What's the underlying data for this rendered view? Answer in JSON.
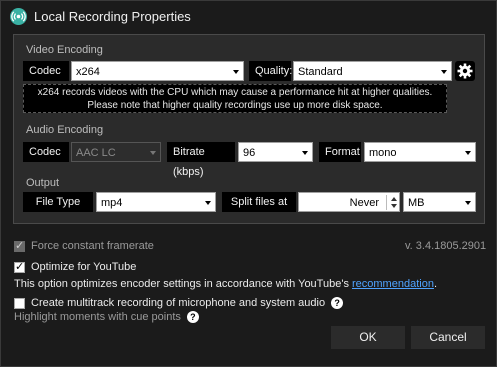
{
  "window": {
    "title": "Local Recording Properties"
  },
  "video": {
    "section_label": "Video Encoding",
    "codec_label": "Codec",
    "codec_value": "x264",
    "quality_label": "Quality:",
    "quality_value": "Standard",
    "info_line1": "x264 records videos with the CPU which may cause a performance hit at higher qualities.",
    "info_line2": "Please note that higher quality recordings use up more disk space."
  },
  "audio": {
    "section_label": "Audio Encoding",
    "codec_label": "Codec",
    "codec_value": "AAC LC",
    "bitrate_label": "Bitrate (kbps)",
    "bitrate_value": "96",
    "format_label": "Format",
    "format_value": "mono"
  },
  "output": {
    "section_label": "Output",
    "filetype_label": "File Type",
    "filetype_value": "mp4",
    "split_label": "Split files at",
    "split_value": "Never",
    "unit_value": "MB"
  },
  "options": {
    "force_cfr_label": "Force constant framerate",
    "version": "v. 3.4.1805.2901",
    "optimize_yt_label": "Optimize for YouTube",
    "optimize_desc_prefix": "This option optimizes encoder settings in accordance with YouTube's ",
    "optimize_desc_link": "recommendation",
    "optimize_desc_suffix": ".",
    "multitrack_label": "Create multitrack recording of microphone and system audio",
    "highlight_label": "Highlight moments with cue points",
    "help_glyph": "?"
  },
  "buttons": {
    "ok": "OK",
    "cancel": "Cancel"
  },
  "colors": {
    "accent": "#3ab1a4",
    "link": "#4fa3ff"
  }
}
